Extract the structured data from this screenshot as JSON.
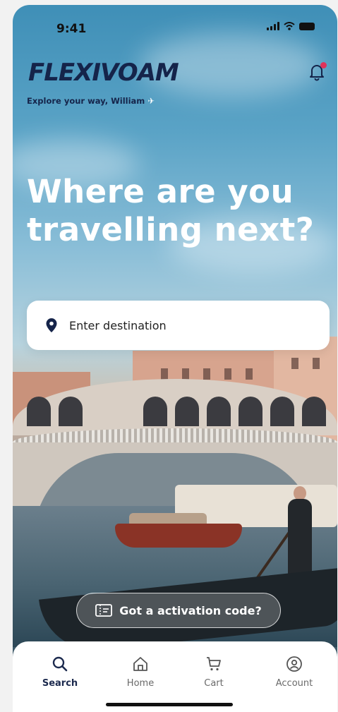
{
  "status_bar": {
    "time": "9:41"
  },
  "header": {
    "logo_text": "FLEXIVOAM",
    "tagline": "Explore your way, William",
    "tagline_icon": "airplane-icon",
    "notification_icon": "bell-icon",
    "notification_dot_color": "#e0325a"
  },
  "hero": {
    "headline": "Where are you travelling next?"
  },
  "search": {
    "placeholder": "Enter destination",
    "icon": "location-pin-icon"
  },
  "activation": {
    "label": "Got a activation code?",
    "icon": "ticket-icon"
  },
  "tabs": [
    {
      "label": "Search",
      "icon": "search-icon",
      "active": true
    },
    {
      "label": "Home",
      "icon": "home-icon",
      "active": false
    },
    {
      "label": "Cart",
      "icon": "cart-icon",
      "active": false
    },
    {
      "label": "Account",
      "icon": "account-icon",
      "active": false
    }
  ],
  "colors": {
    "brand": "#15244a",
    "accent": "#e0325a"
  }
}
